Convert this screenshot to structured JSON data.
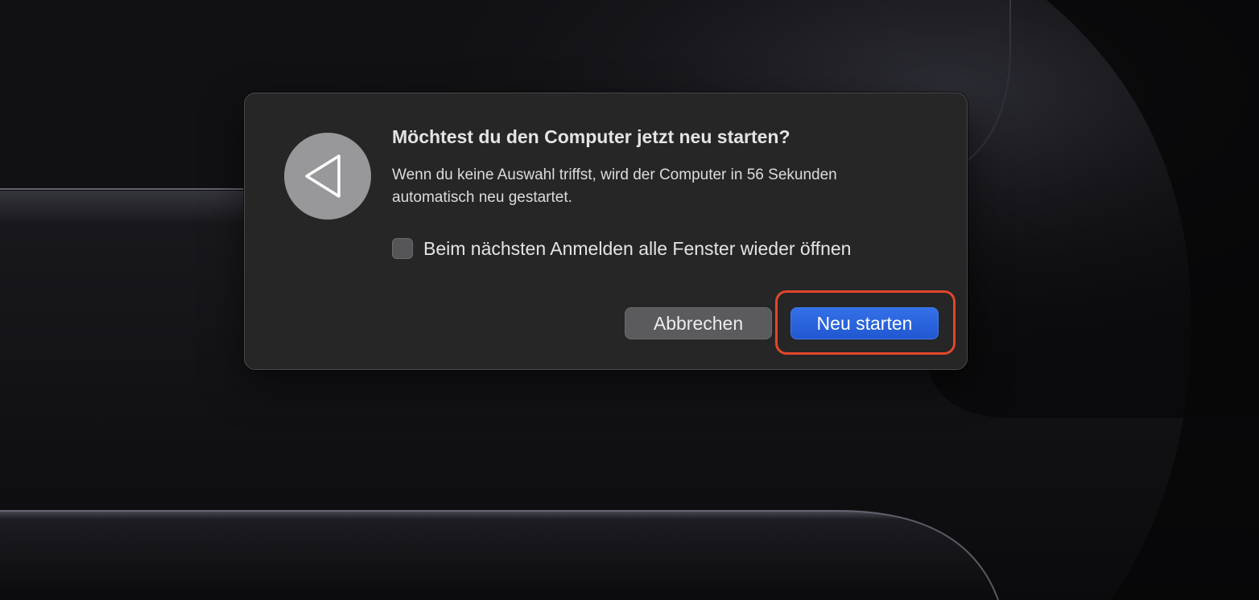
{
  "dialog": {
    "title": "Möchtest du den Computer jetzt neu starten?",
    "message": "Wenn du keine Auswahl triffst, wird der Computer in 56 Sekunden automatisch neu gestartet.",
    "checkbox": {
      "label": "Beim nächsten Anmelden alle Fenster wieder öffnen",
      "checked": false
    },
    "buttons": {
      "cancel_label": "Abbrechen",
      "restart_label": "Neu starten"
    },
    "icon": "restart-arrow-icon"
  },
  "annotation": {
    "highlight_color": "#e2462c",
    "highlighted_target": "restart-button"
  },
  "colors": {
    "accent": "#2158d2",
    "dialog_background": "#262627",
    "desktop_background": "#0a0a0c"
  }
}
